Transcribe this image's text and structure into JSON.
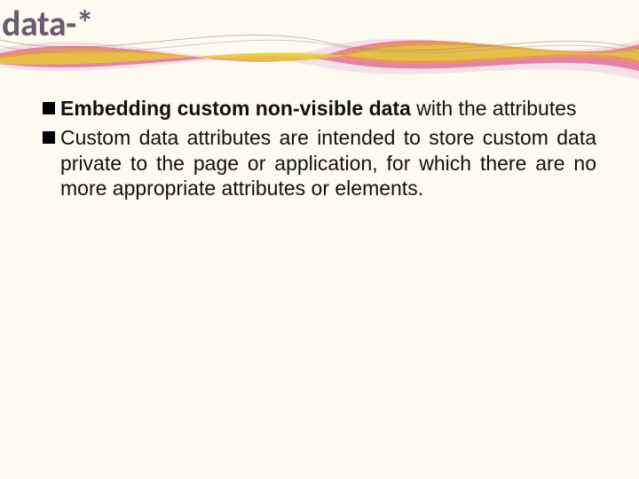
{
  "title": "data-*",
  "bullets": [
    {
      "lead": "Embedding custom non-visible data",
      "rest": " with the attributes"
    },
    {
      "lead": "",
      "rest": "Custom data attributes are intended to store custom data private to the page or application, for which there are no more appropriate attributes or elements."
    }
  ]
}
